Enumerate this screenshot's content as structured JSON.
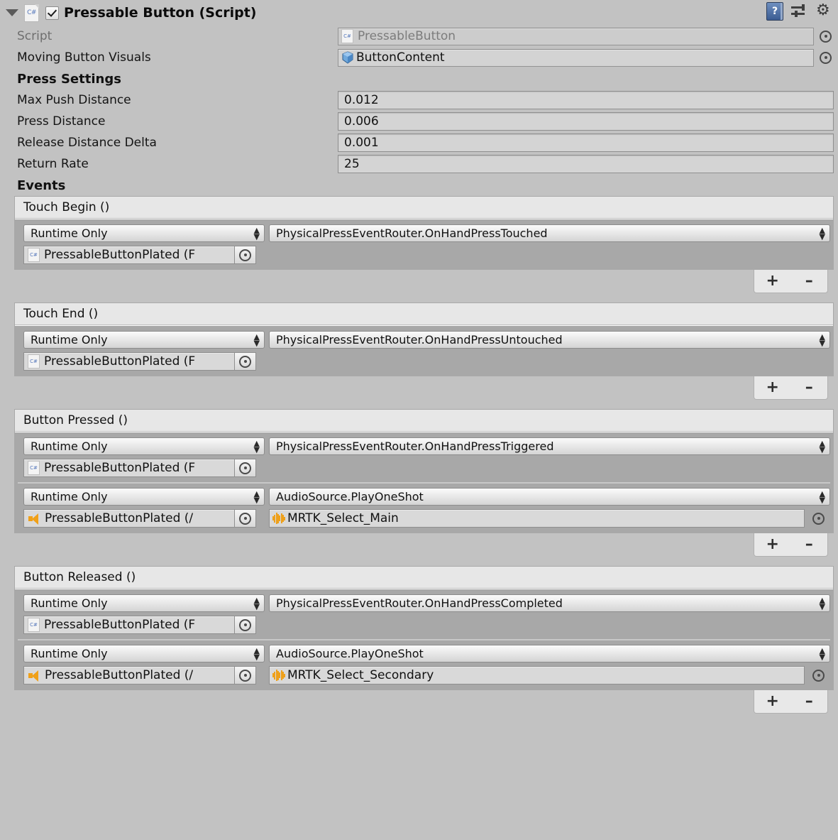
{
  "header": {
    "title": "Pressable Button (Script)",
    "enabled": true,
    "script_icon": "csharp-script-icon",
    "icons": {
      "help": "?",
      "help_name": "help-book-icon",
      "preset_name": "preset-icon",
      "gear_name": "gear-icon"
    }
  },
  "properties": [
    {
      "label": "Script",
      "value": "PressableButton",
      "readonly": true,
      "icon": "csharp-script-icon",
      "has_picker": true
    },
    {
      "label": "Moving Button Visuals",
      "value": "ButtonContent",
      "readonly": false,
      "icon": "prefab-cube-icon",
      "has_picker": true
    }
  ],
  "press_settings": {
    "header": "Press Settings",
    "fields": [
      {
        "label": "Max Push Distance",
        "value": "0.012"
      },
      {
        "label": "Press Distance",
        "value": "0.006"
      },
      {
        "label": "Release Distance Delta",
        "value": "0.001"
      },
      {
        "label": "Return Rate",
        "value": "25"
      }
    ]
  },
  "events_header": "Events",
  "events": [
    {
      "title": "Touch Begin ()",
      "rows": [
        {
          "mode": "Runtime Only",
          "method": "PhysicalPressEventRouter.OnHandPressTouched",
          "target": "PressableButtonPlated (F",
          "target_icon": "csharp-script-icon",
          "argument": null
        }
      ],
      "add_label": "+",
      "remove_label": "–"
    },
    {
      "title": "Touch End ()",
      "rows": [
        {
          "mode": "Runtime Only",
          "method": "PhysicalPressEventRouter.OnHandPressUntouched",
          "target": "PressableButtonPlated (F",
          "target_icon": "csharp-script-icon",
          "argument": null
        }
      ],
      "add_label": "+",
      "remove_label": "–"
    },
    {
      "title": "Button Pressed ()",
      "rows": [
        {
          "mode": "Runtime Only",
          "method": "PhysicalPressEventRouter.OnHandPressTriggered",
          "target": "PressableButtonPlated (F",
          "target_icon": "csharp-script-icon",
          "argument": null
        },
        {
          "mode": "Runtime Only",
          "method": "AudioSource.PlayOneShot",
          "target": "PressableButtonPlated (/",
          "target_icon": "audio-speaker-icon",
          "argument": "MRTK_Select_Main",
          "argument_icon": "audio-clip-icon"
        }
      ],
      "add_label": "+",
      "remove_label": "–"
    },
    {
      "title": "Button Released ()",
      "rows": [
        {
          "mode": "Runtime Only",
          "method": "PhysicalPressEventRouter.OnHandPressCompleted",
          "target": "PressableButtonPlated (F",
          "target_icon": "csharp-script-icon",
          "argument": null
        },
        {
          "mode": "Runtime Only",
          "method": "AudioSource.PlayOneShot",
          "target": "PressableButtonPlated (/",
          "target_icon": "audio-speaker-icon",
          "argument": "MRTK_Select_Secondary",
          "argument_icon": "audio-clip-icon"
        }
      ],
      "add_label": "+",
      "remove_label": "–"
    }
  ],
  "colors": {
    "window_bg": "#c2c2c2",
    "event_body": "#a8a8a8",
    "event_header": "#e7e7e7",
    "field_bg": "#d4d4d4",
    "accent_audio": "#f0a018",
    "accent_script": "#5577bb"
  }
}
